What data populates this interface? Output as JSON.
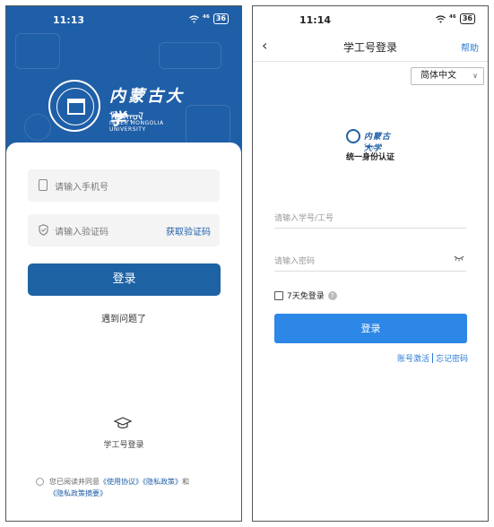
{
  "left": {
    "status": {
      "time": "11:13",
      "signal": "⁴⁶",
      "battery": "36"
    },
    "university": {
      "name_cn": "内蒙古大学",
      "name_mn": "ᠮᠣᠩᠭᠣᠯ",
      "name_en": "INNER MONGOLIA UNIVERSITY"
    },
    "phone_placeholder": "请输入手机号",
    "code_placeholder": "请输入验证码",
    "get_code": "获取验证码",
    "login_button": "登录",
    "problem": "遇到问题了",
    "alt_login": "学工号登录",
    "agreement": {
      "prefix": "您已阅读并同意",
      "terms": "《使用协议》",
      "privacy": "《隐私政策》",
      "and": "和",
      "summary": "《隐私政策摘要》"
    }
  },
  "right": {
    "status": {
      "time": "11:14",
      "signal": "⁴⁶",
      "battery": "36"
    },
    "title": "学工号登录",
    "help": "帮助",
    "language": "简体中文",
    "mini_logo_cn": "内蒙古大学",
    "mini_logo_mn": "ᠮᠣᠩ",
    "auth_title": "统一身份认证",
    "account_placeholder": "请输入学号/工号",
    "password_placeholder": "请输入密码",
    "remember": "7天免登录",
    "login_button": "登录",
    "activate": "账号激活",
    "forgot": "忘记密码"
  },
  "colors": {
    "brand": "#1f5fa8",
    "button_right": "#2d87e6",
    "link": "#2b7bd6"
  },
  "icons": [
    "wifi-icon",
    "battery-icon",
    "phone-icon",
    "shield-icon",
    "graduation-cap-icon",
    "back-arrow-icon",
    "eye-closed-icon",
    "question-icon",
    "chevron-down-icon"
  ]
}
